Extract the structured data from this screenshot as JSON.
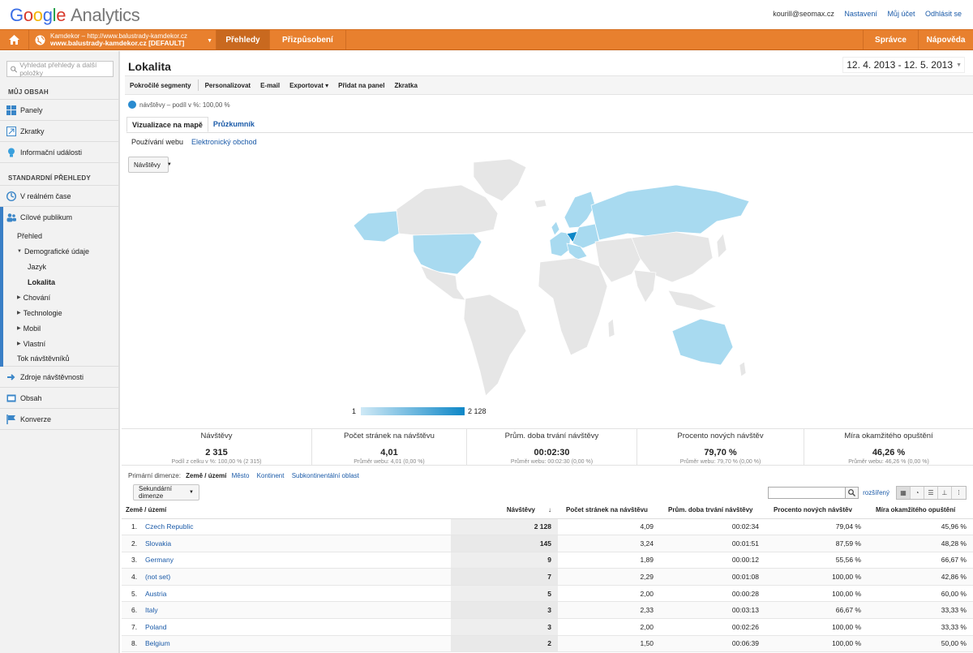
{
  "brand": {
    "google": "Google",
    "product": "Analytics"
  },
  "user": {
    "email": "kourill@seomax.cz",
    "settings": "Nastavení",
    "account": "Můj účet",
    "logout": "Odhlásit se"
  },
  "nav": {
    "account_line1": "Kamdekor – http://www.balustrady-kamdekor.cz",
    "account_line2": "www.balustrady-kamdekor.cz [DEFAULT]",
    "tabs": [
      "Přehledy",
      "Přizpůsobení"
    ],
    "right_tabs": [
      "Správce",
      "Nápověda"
    ]
  },
  "sidebar": {
    "search_placeholder": "Vyhledat přehledy a další položky",
    "my_content_heading": "MŮJ OBSAH",
    "my_content": [
      "Panely",
      "Zkratky",
      "Informační události"
    ],
    "standard_heading": "STANDARDNÍ PŘEHLEDY",
    "realtime": "V reálném čase",
    "audience": "Cílové publikum",
    "audience_items": {
      "overview": "Přehled",
      "demographics": "Demografické údaje",
      "language": "Jazyk",
      "location": "Lokalita",
      "behavior": "Chování",
      "technology": "Technologie",
      "mobile": "Mobil",
      "custom": "Vlastní",
      "flow": "Tok návštěvníků"
    },
    "sources": "Zdroje návštěvnosti",
    "content": "Obsah",
    "conversions": "Konverze"
  },
  "page": {
    "title": "Lokalita",
    "date_range": "12. 4. 2013 - 12. 5. 2013",
    "toolbar": [
      "Pokročilé segmenty",
      "Personalizovat",
      "E-mail",
      "Exportovat ▾",
      "Přidat na panel",
      "Zkratka"
    ],
    "segment": "návštěvy – podíl v %: 100,00 %",
    "tabs": [
      "Vizualizace na mapě",
      "Průzkumník"
    ],
    "subtabs": [
      "Používání webu",
      "Elektronický obchod"
    ],
    "metric_dropdown": "Návštěvy",
    "legend_min": "1",
    "legend_max": "2 128"
  },
  "metrics": [
    {
      "label": "Návštěvy",
      "value": "2 315",
      "sub": "Podíl z celku v %: 100,00 % (2 315)"
    },
    {
      "label": "Počet stránek na návštěvu",
      "value": "4,01",
      "sub": "Průměr webu: 4,01 (0,00 %)"
    },
    {
      "label": "Prům. doba trvání návštěvy",
      "value": "00:02:30",
      "sub": "Průměr webu: 00:02:30 (0,00 %)"
    },
    {
      "label": "Procento nových návštěv",
      "value": "79,70 %",
      "sub": "Průměr webu: 79,70 % (0,00 %)"
    },
    {
      "label": "Míra okamžitého opuštění",
      "value": "46,26 %",
      "sub": "Průměr webu: 46,26 % (0,00 %)"
    }
  ],
  "dimensions": {
    "label": "Primární dimenze:",
    "active": "Země / území",
    "others": [
      "Město",
      "Kontinent",
      "Subkontinentální oblast"
    ],
    "secondary": "Sekundární dimenze",
    "extended": "rozšířený"
  },
  "table": {
    "headers": [
      "Země / území",
      "Návštěvy",
      "Počet stránek na návštěvu",
      "Prům. doba trvání návštěvy",
      "Procento nových návštěv",
      "Míra okamžitého opuštění"
    ],
    "rows": [
      [
        "1.",
        "Czech Republic",
        "2 128",
        "4,09",
        "00:02:34",
        "79,04 %",
        "45,96 %"
      ],
      [
        "2.",
        "Slovakia",
        "145",
        "3,24",
        "00:01:51",
        "87,59 %",
        "48,28 %"
      ],
      [
        "3.",
        "Germany",
        "9",
        "1,89",
        "00:00:12",
        "55,56 %",
        "66,67 %"
      ],
      [
        "4.",
        "(not set)",
        "7",
        "2,29",
        "00:01:08",
        "100,00 %",
        "42,86 %"
      ],
      [
        "5.",
        "Austria",
        "5",
        "2,00",
        "00:00:28",
        "100,00 %",
        "60,00 %"
      ],
      [
        "6.",
        "Italy",
        "3",
        "2,33",
        "00:03:13",
        "66,67 %",
        "33,33 %"
      ],
      [
        "7.",
        "Poland",
        "3",
        "2,00",
        "00:02:26",
        "100,00 %",
        "33,33 %"
      ],
      [
        "8.",
        "Belgium",
        "2",
        "1,50",
        "00:06:39",
        "100,00 %",
        "50,00 %"
      ]
    ]
  },
  "colors": {
    "nav": "#e8802e",
    "map_low": "#cfe9f6",
    "map_high": "#0e87c7",
    "map_none": "#e6e6e6",
    "link": "#1a5aa8"
  }
}
